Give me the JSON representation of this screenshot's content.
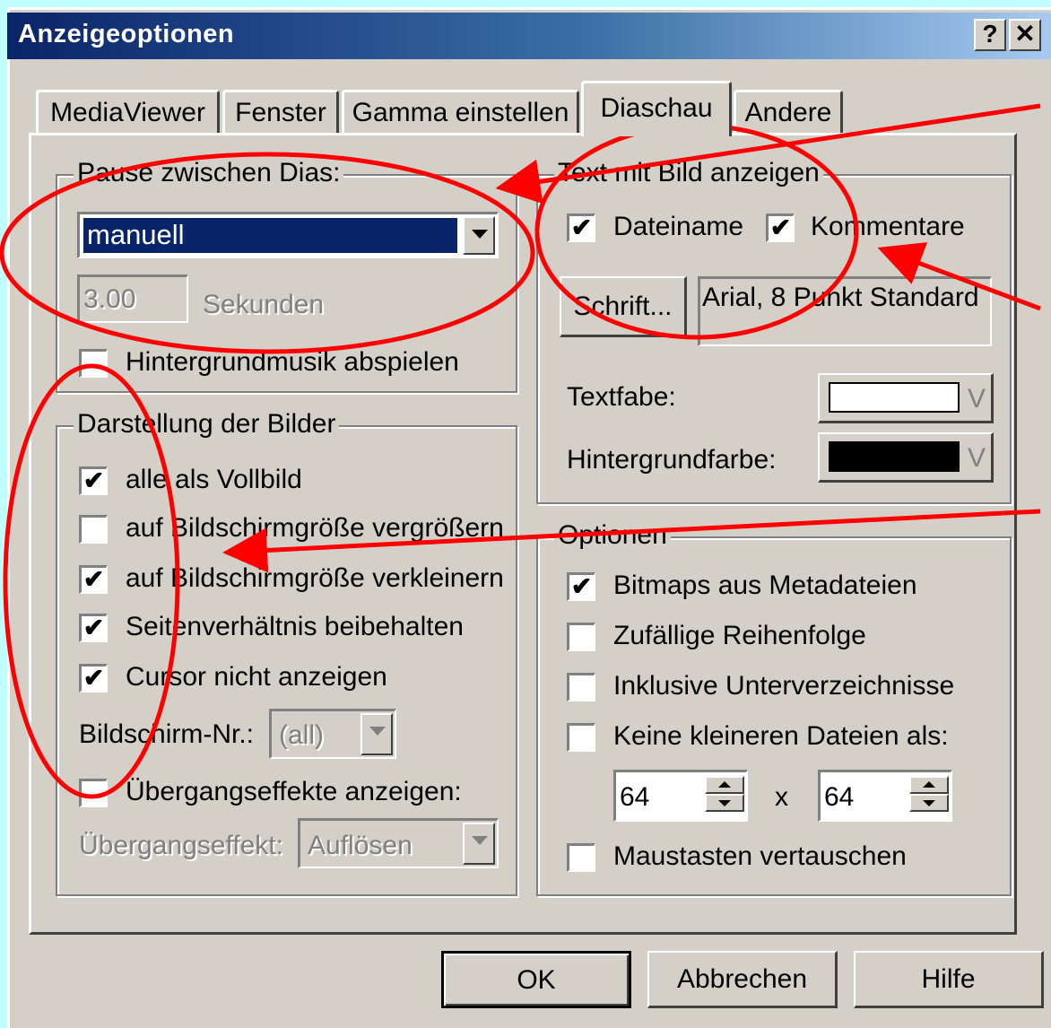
{
  "window": {
    "title": "Anzeigeoptionen",
    "help_label": "?",
    "close_label": "✕"
  },
  "tabs": [
    {
      "label": "MediaViewer",
      "active": false
    },
    {
      "label": "Fenster",
      "active": false
    },
    {
      "label": "Gamma einstellen",
      "active": false
    },
    {
      "label": "Diaschau",
      "active": true
    },
    {
      "label": "Andere",
      "active": false
    }
  ],
  "pause": {
    "legend": "Pause zwischen Dias:",
    "selected": "manuell",
    "seconds_value": "3.00",
    "seconds_unit": "Sekunden",
    "music_label": "Hintergrundmusik abspielen",
    "music_checked": false
  },
  "darstellung": {
    "legend": "Darstellung der Bilder",
    "options": [
      {
        "label": "alle als Vollbild",
        "checked": true
      },
      {
        "label": "auf Bildschirmgröße vergrößern",
        "checked": false
      },
      {
        "label": "auf Bildschirmgröße verkleinern",
        "checked": true
      },
      {
        "label": "Seitenverhältnis beibehalten",
        "checked": true
      },
      {
        "label": "Cursor nicht anzeigen",
        "checked": true
      }
    ],
    "screen_label": "Bildschirm-Nr.:",
    "screen_value": "(all)",
    "transitions_label": "Übergangseffekte anzeigen:",
    "transitions_checked": false,
    "effect_label": "Übergangseffekt:",
    "effect_value": "Auflösen"
  },
  "text": {
    "legend": "Text mit Bild anzeigen",
    "filename_label": "Dateiname",
    "filename_checked": true,
    "comments_label": "Kommentare",
    "comments_checked": true,
    "font_button": "Schrift...",
    "font_value": "Arial, 8 Punkt Standard",
    "textcolor_label": "Textfabe:",
    "textcolor": "#ffffff",
    "bgcolor_label": "Hintergrundfarbe:",
    "bgcolor": "#000000",
    "color_arrow": "V"
  },
  "optionen": {
    "legend": "Optionen",
    "options": [
      {
        "label": "Bitmaps aus Metadateien",
        "checked": true
      },
      {
        "label": "Zufällige Reihenfolge",
        "checked": false
      },
      {
        "label": "Inklusive Unterverzeichnisse",
        "checked": false
      },
      {
        "label": "Keine kleineren Dateien als:",
        "checked": false
      }
    ],
    "width_value": "64",
    "times": "x",
    "height_value": "64",
    "swap_label": "Maustasten vertauschen",
    "swap_checked": false
  },
  "buttons": {
    "ok": "OK",
    "cancel": "Abbrechen",
    "help": "Hilfe"
  },
  "annotation_color": "#ff0000",
  "check_glyph": "✔"
}
